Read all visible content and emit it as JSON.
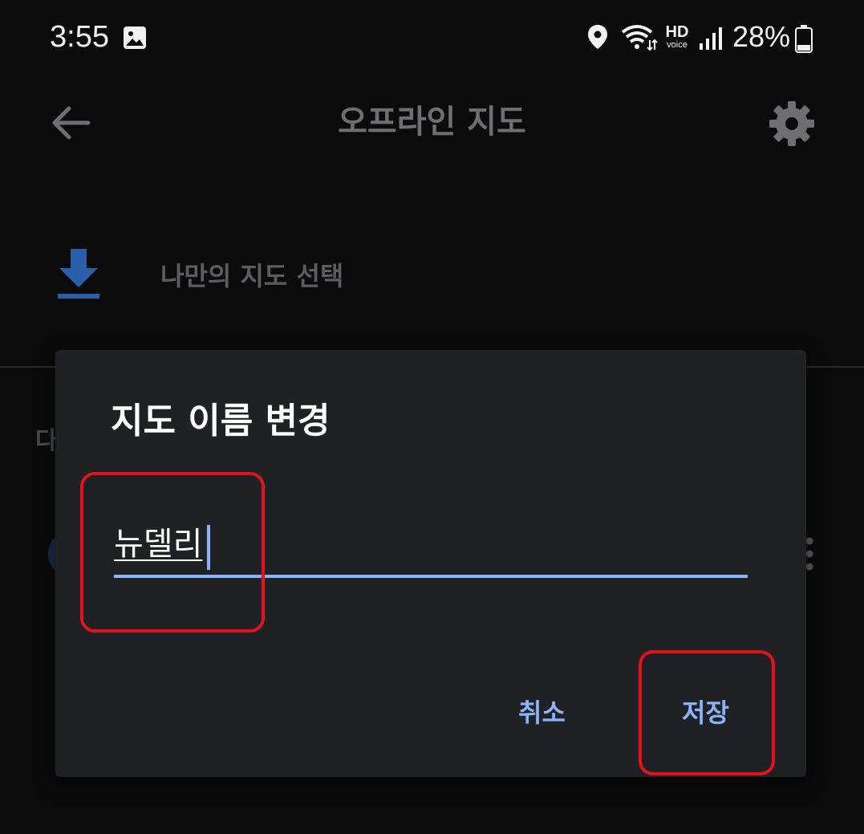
{
  "status_bar": {
    "time": "3:55",
    "battery_percent": "28%",
    "hd_label": "HD",
    "voice_label": "voice",
    "icons": [
      "image-icon",
      "location-icon",
      "wifi-icon",
      "hd-voice-icon",
      "signal-icon",
      "battery-icon"
    ]
  },
  "app_bar": {
    "title": "오프라인 지도",
    "back_icon": "arrow-back-icon",
    "settings_icon": "gear-icon"
  },
  "background": {
    "custom_map_label": "나만의 지도 선택",
    "section_hint": "다"
  },
  "dialog": {
    "title": "지도 이름 변경",
    "input_value": "뉴델리",
    "cancel_label": "취소",
    "save_label": "저장"
  },
  "colors": {
    "accent": "#8ab4f8",
    "dialog_bg": "#202124",
    "page_bg": "#0b0b0c",
    "highlight": "#e0131c",
    "download_icon": "#2a5ea8"
  }
}
